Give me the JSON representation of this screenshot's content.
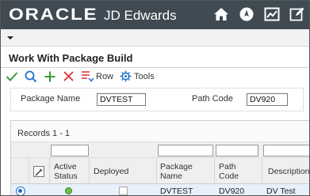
{
  "header": {
    "logo_oracle": "ORACLE",
    "logo_product": "JD Edwards",
    "icons": [
      "home-icon",
      "navigator-icon",
      "reports-icon",
      "edit-icon"
    ]
  },
  "form": {
    "title": "Work With Package Build"
  },
  "toolbar": {
    "select_icon": "checkmark-icon",
    "find_icon": "search-icon",
    "add_icon": "plus-icon",
    "delete_icon": "close-icon",
    "row_label": "Row",
    "tools_label": "Tools"
  },
  "filters": {
    "package_name_label": "Package Name",
    "package_name_value": "DVTEST",
    "path_code_label": "Path Code",
    "path_code_value": "DV920"
  },
  "grid": {
    "records_label": "Records 1 - 1",
    "columns": {
      "active_status": "Active Status",
      "deployed": "Deployed",
      "package_name": "Package Name",
      "path_code": "Path Code",
      "description": "Description"
    },
    "rows": [
      {
        "package_name": "DVTEST",
        "path_code": "DV920",
        "description": "DV Test",
        "active_status_color": "#6cc24a",
        "selected": true
      }
    ]
  },
  "colors": {
    "header_bg": "#3f4a52",
    "accent_blue": "#1f6fc8",
    "ok_green": "#3a9a3a",
    "delete_red": "#d93030"
  }
}
